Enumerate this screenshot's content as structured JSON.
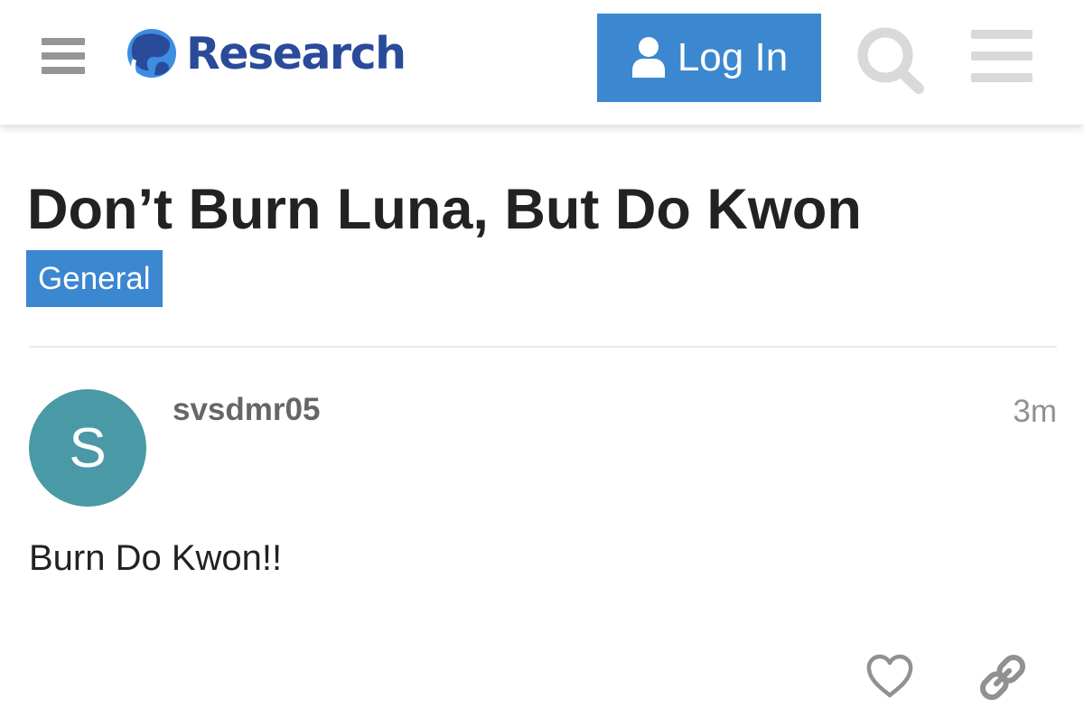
{
  "header": {
    "logo_text": "Research",
    "login_label": "Log In",
    "icons": {
      "menu_left": "hamburger-menu-icon",
      "logo_mark": "globe-logo-icon",
      "login": "user-icon",
      "search": "search-icon",
      "menu_right": "hamburger-menu-icon"
    }
  },
  "topic": {
    "title": "Don’t Burn Luna, But Do Kwon",
    "category": "General"
  },
  "post": {
    "avatar_letter": "S",
    "username": "svsdmr05",
    "age": "3m",
    "body": "Burn Do Kwon!!",
    "actions": {
      "like_icon": "heart-icon",
      "share_icon": "link-icon"
    }
  },
  "colors": {
    "accent": "#3b87d0",
    "logo_text": "#2a4a9a",
    "avatar": "#4a99a6",
    "title_text": "#222222",
    "muted": "#919191"
  }
}
